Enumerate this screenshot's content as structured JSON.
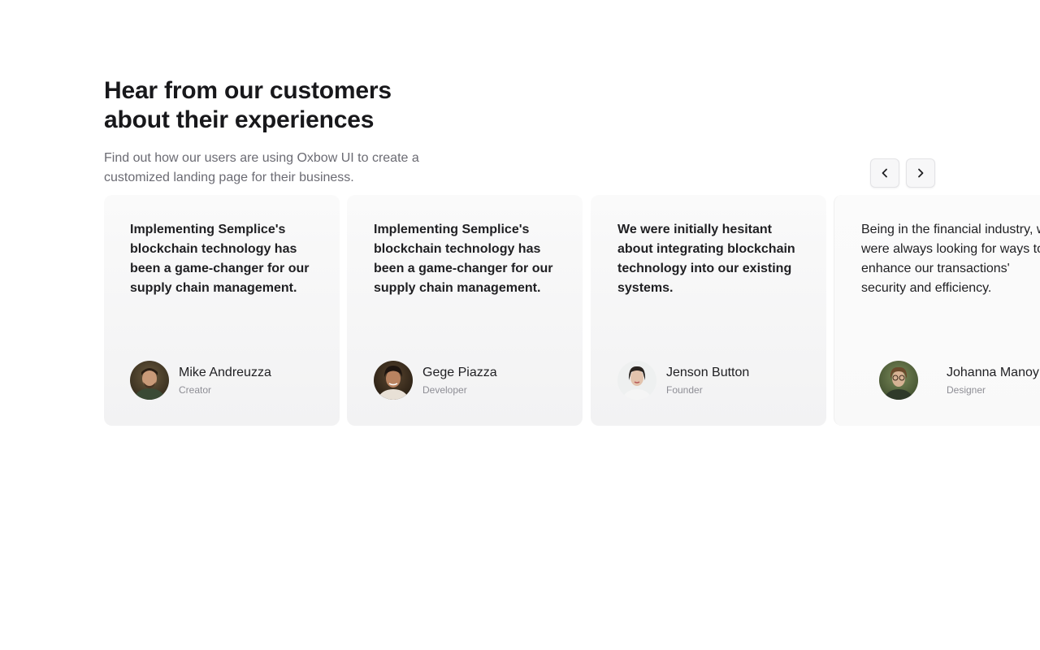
{
  "header": {
    "title": "Hear from our customers about their experiences",
    "subtitle": "Find out how our users are using Oxbow UI to create a customized landing page for their business."
  },
  "carousel": {
    "prev_icon": "chevron-left-icon",
    "next_icon": "chevron-right-icon"
  },
  "testimonials": [
    {
      "quote": "Implementing Semplice's blockchain technology has been a game-changer for our supply chain management.",
      "name": "Mike Andreuzza",
      "role": "Creator"
    },
    {
      "quote": "Implementing Semplice's blockchain technology has been a game-changer for our supply chain management.",
      "name": "Gege Piazza",
      "role": "Developer"
    },
    {
      "quote": "We were initially hesitant about integrating blockchain technology into our existing systems.",
      "name": "Jenson Button",
      "role": "Founder"
    },
    {
      "quote": "Being in the financial industry, we were always looking for ways to enhance our transactions' security and efficiency.",
      "name": "Johanna Manoy",
      "role": "Designer"
    }
  ],
  "colors": {
    "heading": "#18181b",
    "subtitle": "#6b6b73",
    "card_background": "#f5f5f6",
    "role_text": "#8e8e95"
  }
}
